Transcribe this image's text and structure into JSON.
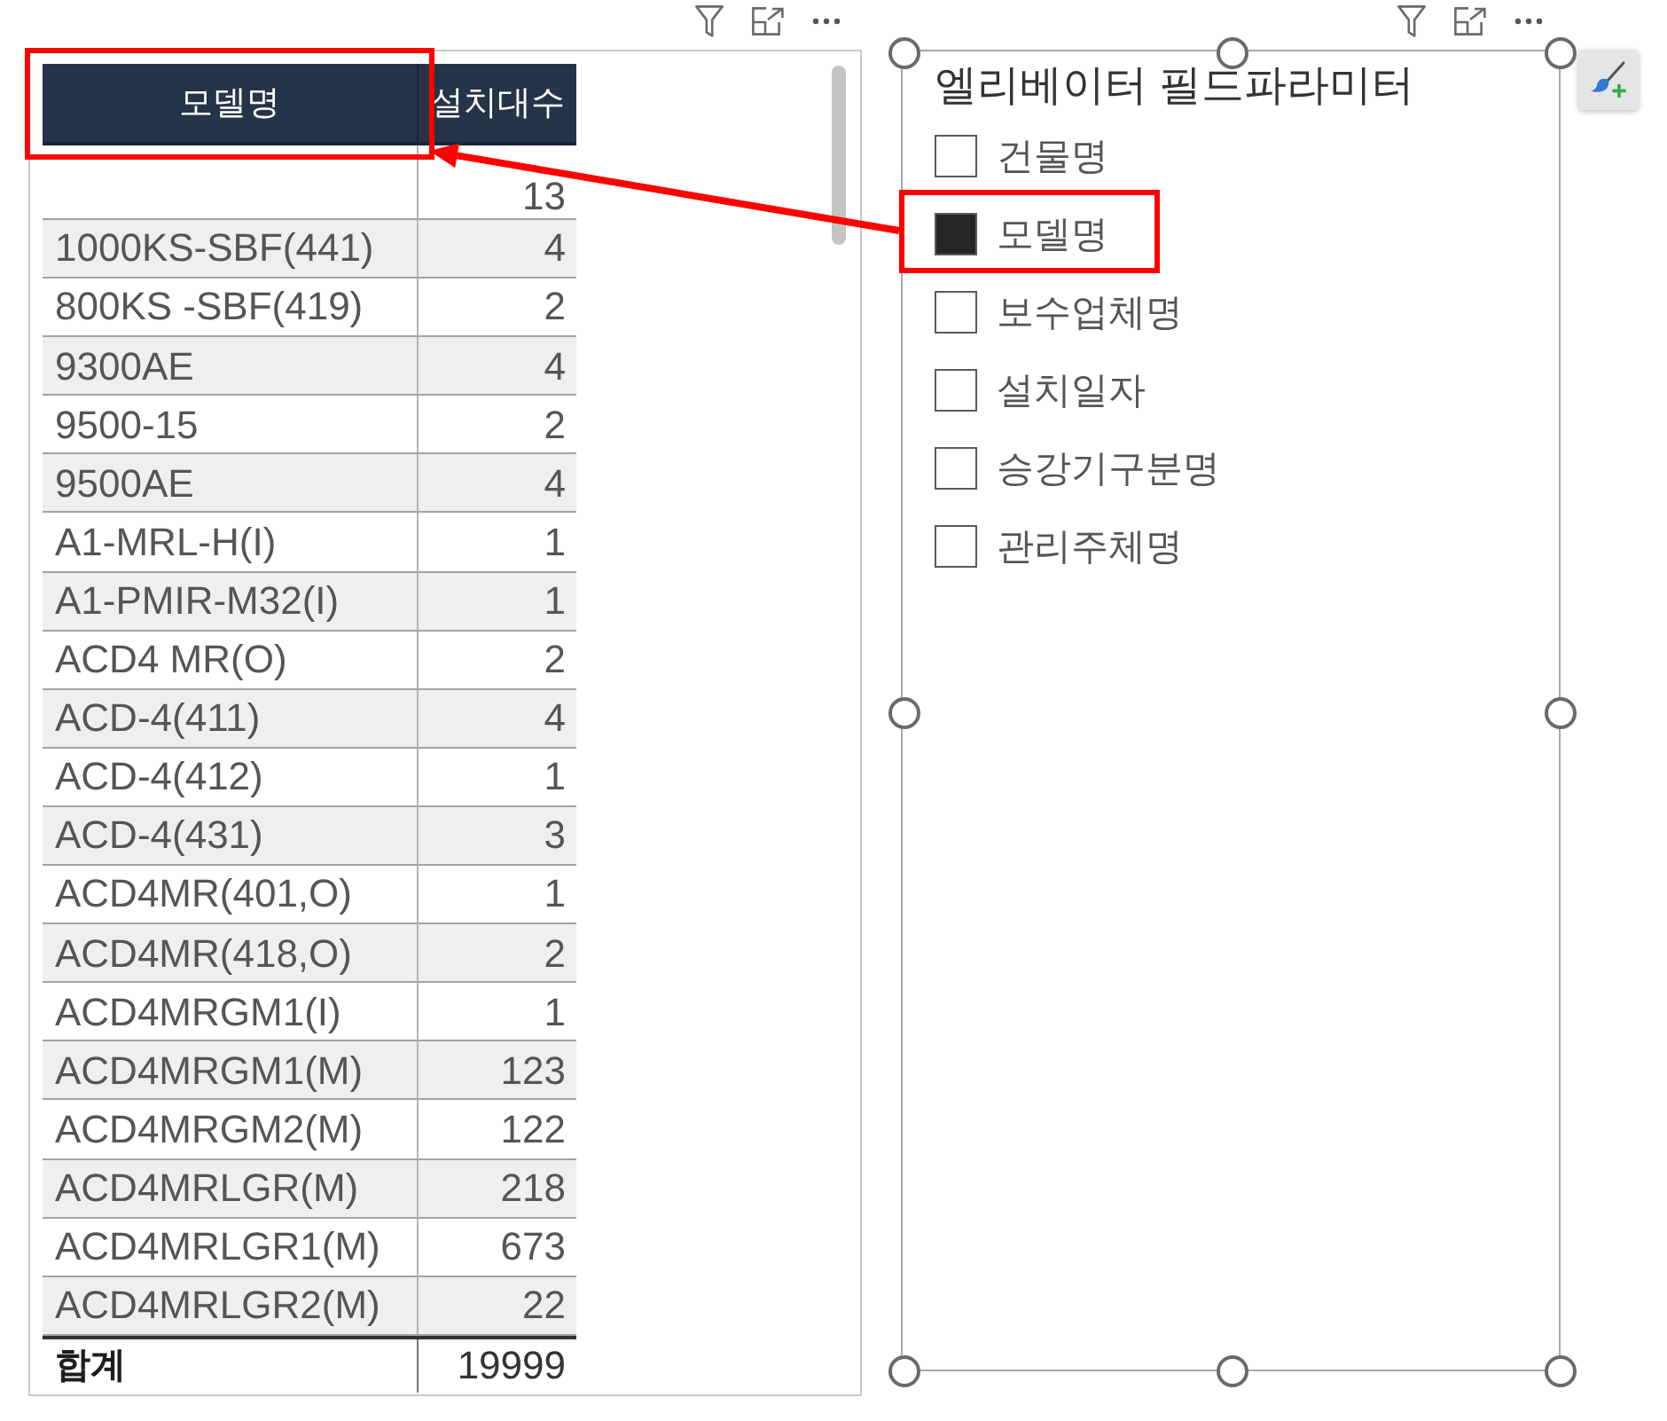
{
  "table": {
    "columns": [
      "모델명",
      "설치대수"
    ],
    "rows": [
      {
        "count": "13"
      },
      {
        "model": "1000KS-SBF(441)",
        "count": "4"
      },
      {
        "model": "800KS -SBF(419)",
        "count": "2"
      },
      {
        "model": "9300AE",
        "count": "4"
      },
      {
        "model": "9500-15",
        "count": "2"
      },
      {
        "model": "9500AE",
        "count": "4"
      },
      {
        "model": "A1-MRL-H(I)",
        "count": "1"
      },
      {
        "model": "A1-PMIR-M32(I)",
        "count": "1"
      },
      {
        "model": "ACD4 MR(O)",
        "count": "2"
      },
      {
        "model": "ACD-4(411)",
        "count": "4"
      },
      {
        "model": "ACD-4(412)",
        "count": "1"
      },
      {
        "model": "ACD-4(431)",
        "count": "3"
      },
      {
        "model": "ACD4MR(401,O)",
        "count": "1"
      },
      {
        "model": "ACD4MR(418,O)",
        "count": "2"
      },
      {
        "model": "ACD4MRGM1(I)",
        "count": "1"
      },
      {
        "model": "ACD4MRGM1(M)",
        "count": "123"
      },
      {
        "model": "ACD4MRGM2(M)",
        "count": "122"
      },
      {
        "model": "ACD4MRLGR(M)",
        "count": "218"
      },
      {
        "model": "ACD4MRLGR1(M)",
        "count": "673"
      },
      {
        "model": "ACD4MRLGR2(M)",
        "count": "22"
      }
    ],
    "total": {
      "label": "합계",
      "value": "19999"
    }
  },
  "slicer": {
    "title": "엘리베이터 필드파라미터",
    "items": [
      {
        "label": "건물명",
        "checked": false
      },
      {
        "label": "모델명",
        "checked": true
      },
      {
        "label": "보수업체명",
        "checked": false
      },
      {
        "label": "설치일자",
        "checked": false
      },
      {
        "label": "승강기구분명",
        "checked": false
      },
      {
        "label": "관리주체명",
        "checked": false
      }
    ]
  }
}
